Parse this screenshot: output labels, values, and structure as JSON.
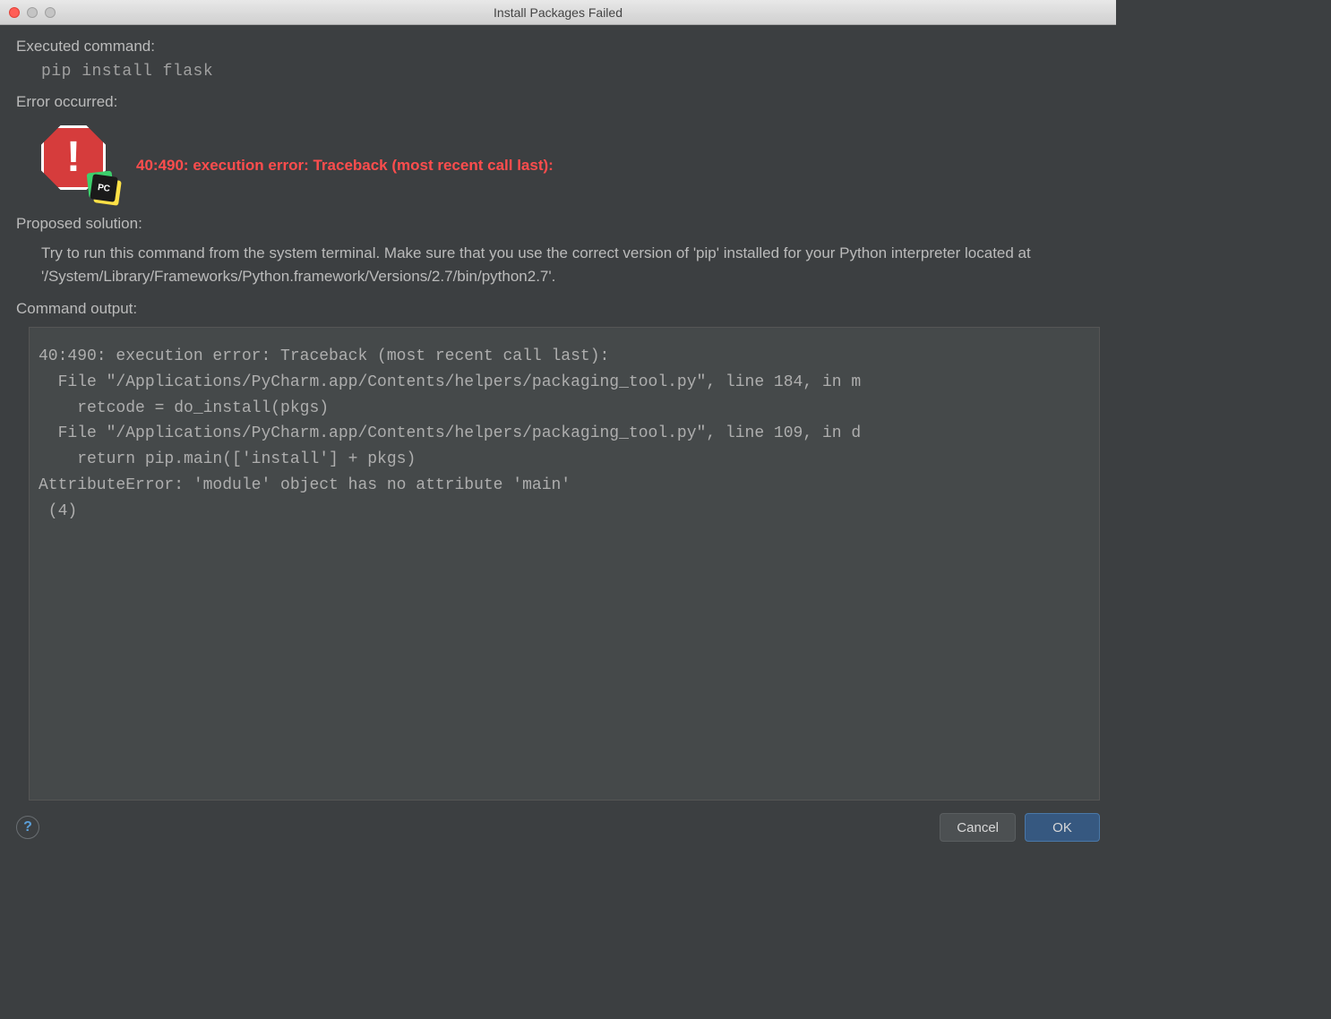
{
  "window": {
    "title": "Install Packages Failed"
  },
  "sections": {
    "executed_label": "Executed command:",
    "executed_command": "pip install flask",
    "error_label": "Error occurred:",
    "error_message": "40:490: execution error: Traceback (most recent call last):",
    "proposed_label": "Proposed solution:",
    "proposed_text": "Try to run this command from the system terminal. Make sure that you use the correct version of 'pip' installed for your Python interpreter located at '/System/Library/Frameworks/Python.framework/Versions/2.7/bin/python2.7'.",
    "output_label": "Command output:",
    "output_text": "40:490: execution error: Traceback (most recent call last):\n  File \"/Applications/PyCharm.app/Contents/helpers/packaging_tool.py\", line 184, in m\n    retcode = do_install(pkgs)\n  File \"/Applications/PyCharm.app/Contents/helpers/packaging_tool.py\", line 109, in d\n    return pip.main(['install'] + pkgs)\nAttributeError: 'module' object has no attribute 'main'\n (4)"
  },
  "icons": {
    "error_badge": "PC",
    "error_bang": "!"
  },
  "buttons": {
    "help": "?",
    "cancel": "Cancel",
    "ok": "OK"
  }
}
